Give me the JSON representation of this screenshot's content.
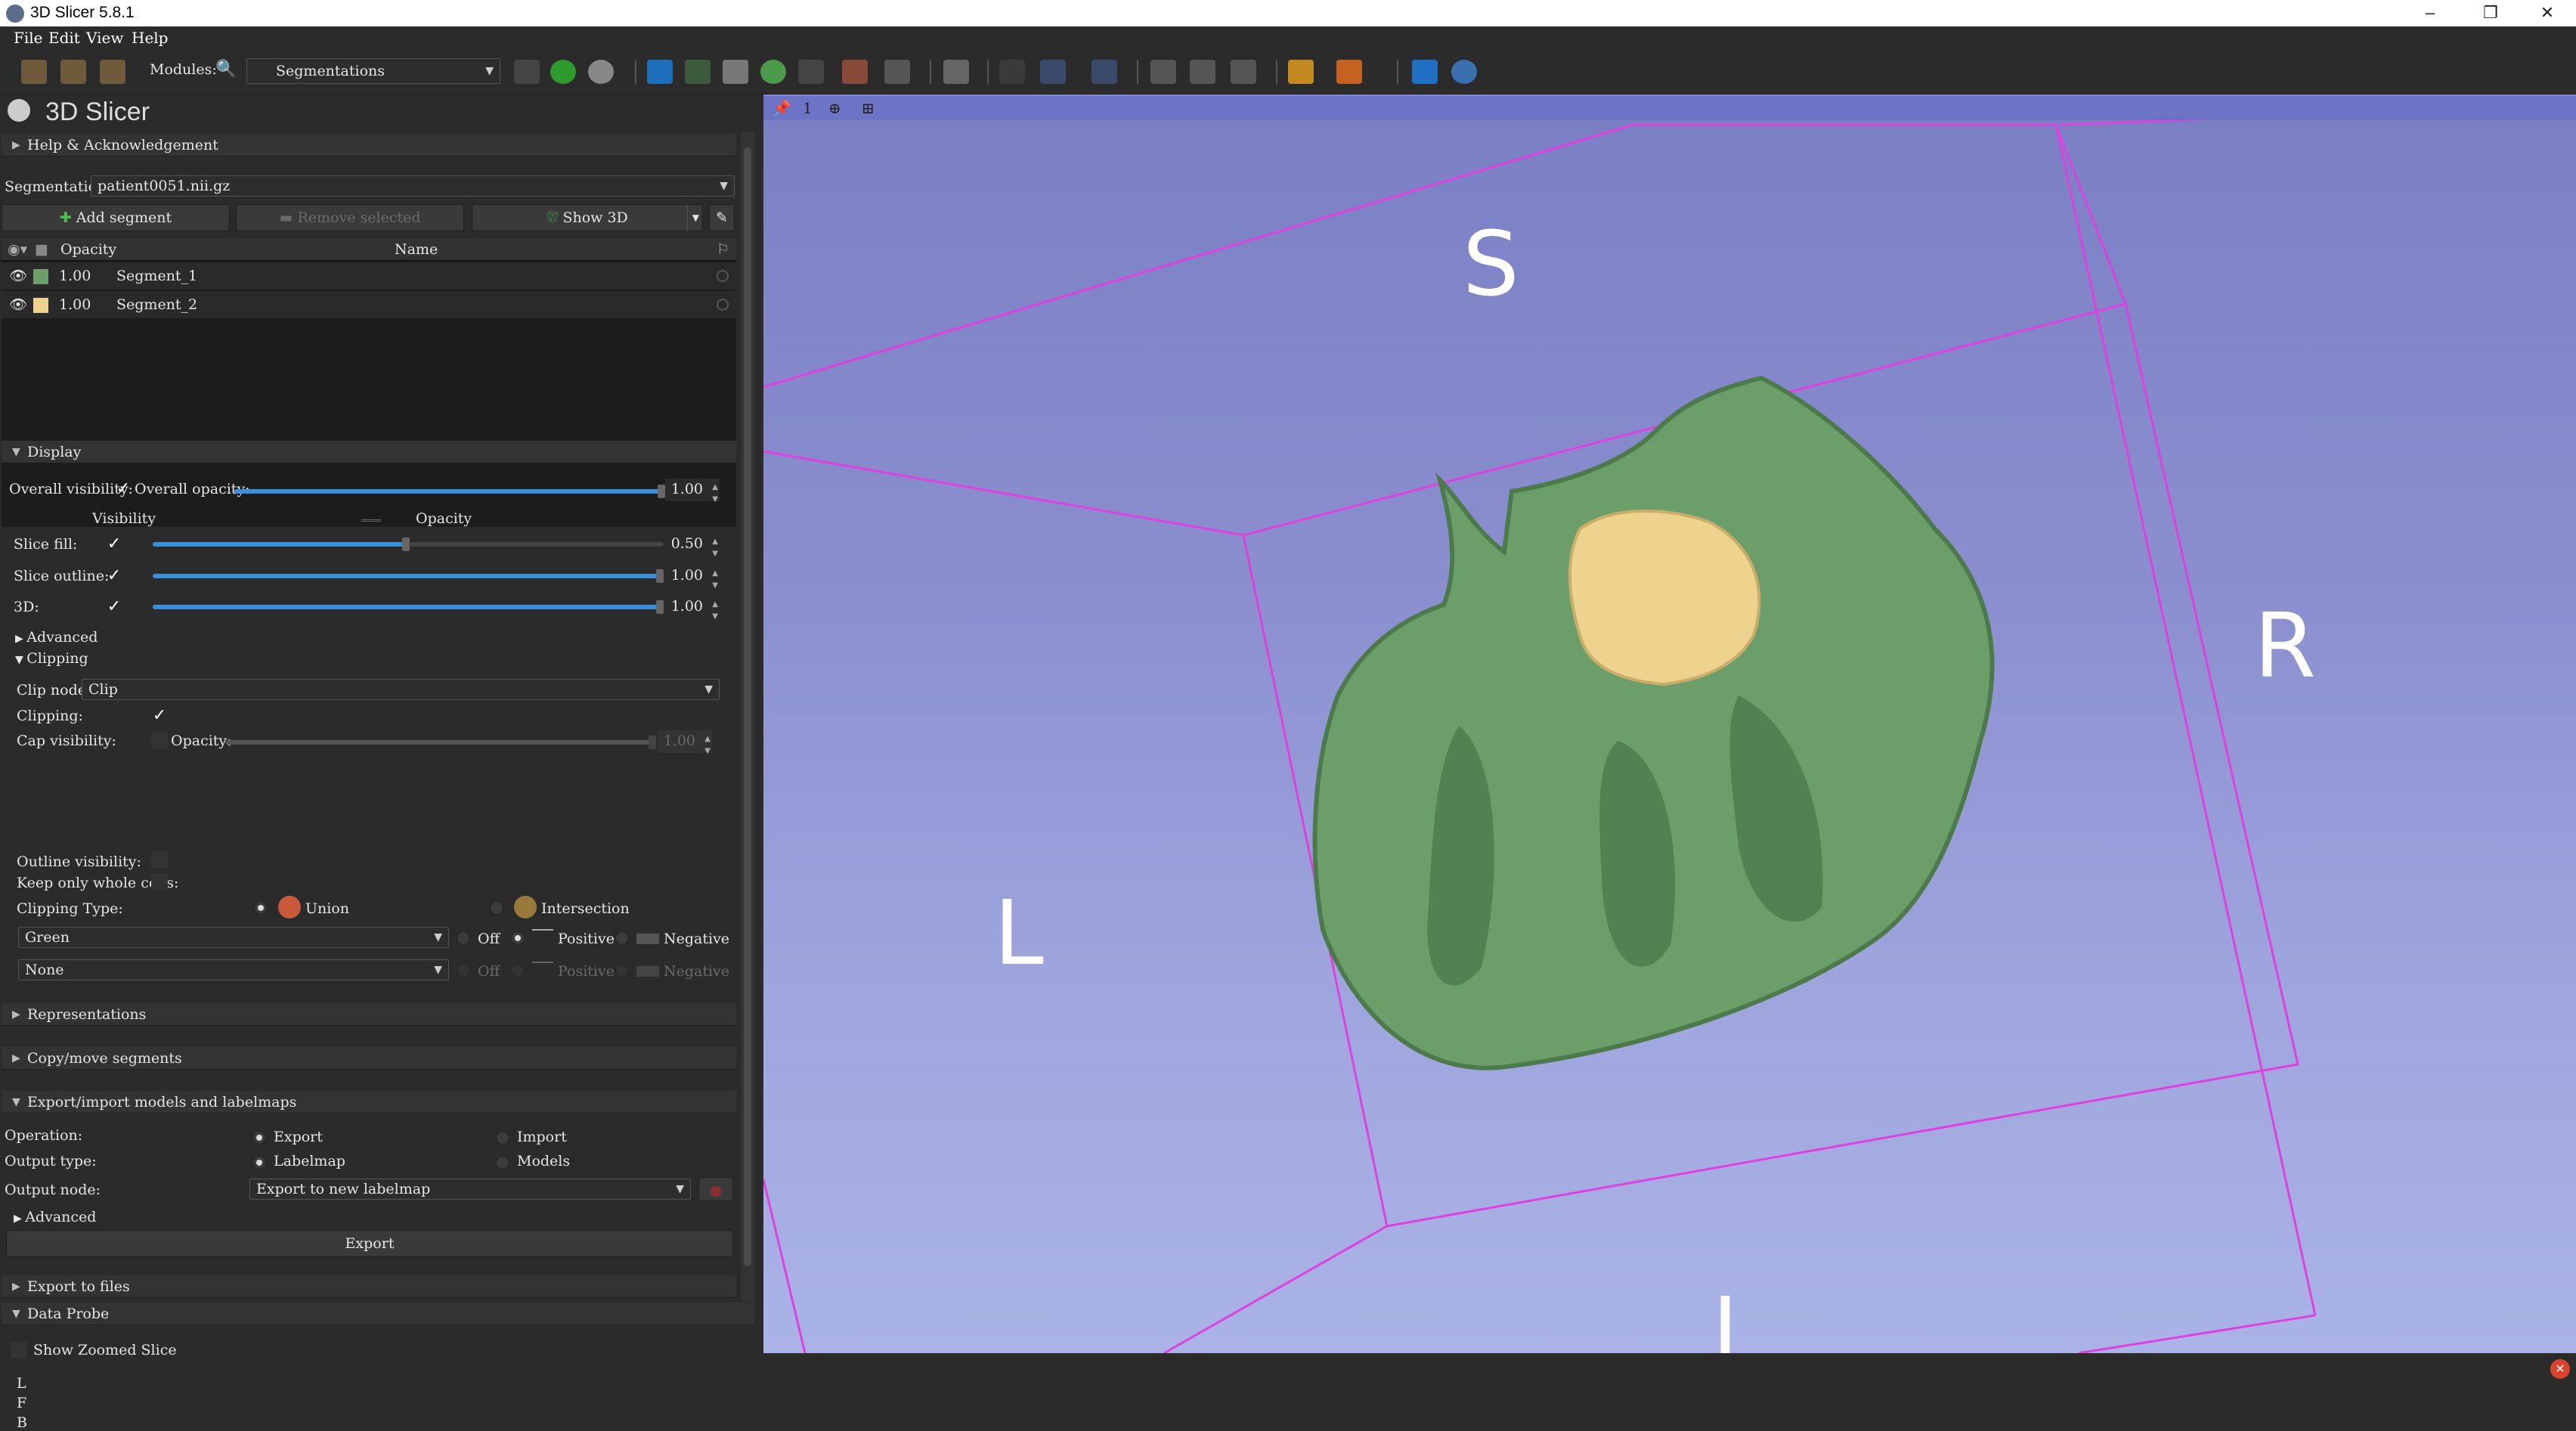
{
  "app": {
    "title": "3D Slicer 5.8.1"
  },
  "menu": [
    "File",
    "Edit",
    "View",
    "Help"
  ],
  "toolbar": {
    "modules_label": "Modules:",
    "module_value": "Segmentations"
  },
  "panel": {
    "logo_text": "3D Slicer",
    "help_section": "Help & Acknowledgement",
    "segmentation_label": "Segmentation:",
    "segmentation_value": "patient0051.nii.gz",
    "add_segment": "Add segment",
    "remove_selected": "Remove selected",
    "show_3d": "Show 3D",
    "table_headers": {
      "opacity": "Opacity",
      "name": "Name"
    },
    "segments": [
      {
        "opacity": "1.00",
        "name": "Segment_1",
        "color": "#6c9e6a"
      },
      {
        "opacity": "1.00",
        "name": "Segment_2",
        "color": "#eed38f"
      }
    ],
    "display": {
      "title": "Display",
      "overall_visibility": "Overall visibility:",
      "overall_opacity": "Overall opacity:",
      "overall_opacity_value": "1.00",
      "col_visibility": "Visibility",
      "col_opacity": "Opacity",
      "slice_fill": "Slice fill:",
      "slice_fill_value": "0.50",
      "slice_outline": "Slice outline:",
      "slice_outline_value": "1.00",
      "threed": "3D:",
      "threed_value": "1.00",
      "advanced": "Advanced"
    },
    "clipping": {
      "title": "Clipping",
      "clip_node_label": "Clip node:",
      "clip_node_value": "Clip",
      "clipping_label": "Clipping:",
      "cap_visibility": "Cap visibility:",
      "cap_opacity": "Opacity:",
      "cap_opacity_value": "1.00",
      "outline_visibility": "Outline visibility:",
      "keep_whole_cells": "Keep only whole cells:",
      "clipping_type": "Clipping Type:",
      "union": "Union",
      "intersection": "Intersection",
      "row1_combo": "Green",
      "row2_combo": "None",
      "off": "Off",
      "positive": "Positive",
      "negative": "Negative"
    },
    "representations": "Representations",
    "copy_move": "Copy/move segments",
    "export_import": {
      "title": "Export/import models and labelmaps",
      "operation": "Operation:",
      "export": "Export",
      "import": "Import",
      "output_type": "Output type:",
      "labelmap": "Labelmap",
      "models": "Models",
      "output_node": "Output node:",
      "output_node_value": "Export to new labelmap",
      "advanced": "Advanced",
      "export_button": "Export"
    },
    "export_files": "Export to files",
    "data_probe": {
      "title": "Data Probe",
      "show_zoomed": "Show Zoomed Slice",
      "coords": [
        "L",
        "F",
        "B"
      ]
    }
  },
  "view": {
    "index": "1",
    "labels": {
      "superior": "S",
      "right": "R",
      "left": "L",
      "inferior": "I"
    },
    "bg_top": "#7a7fc4",
    "bg_bottom": "#aab3e6",
    "box_color": "#e040e0",
    "segment_colors": [
      "#6c9e6a",
      "#eed38f"
    ]
  }
}
